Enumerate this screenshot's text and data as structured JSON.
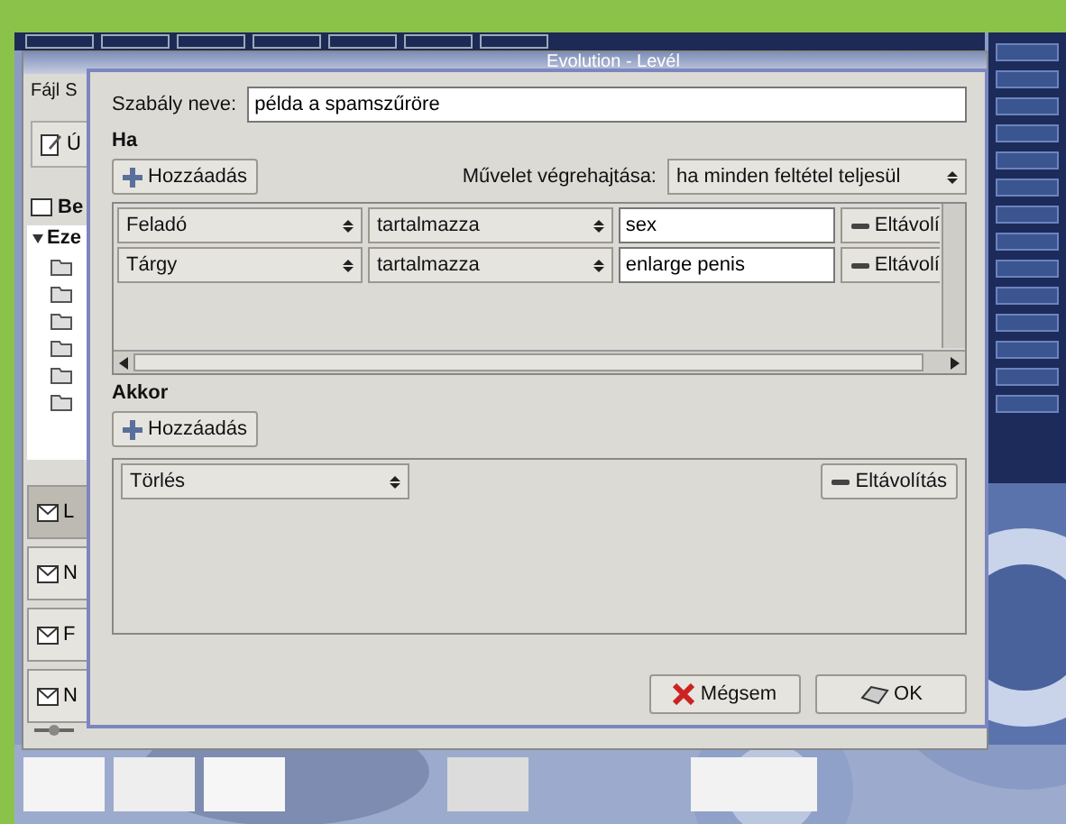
{
  "background_window": {
    "title": "Evolution - Levél",
    "menu": [
      "Fájl",
      "S"
    ],
    "toolbar_button": "Ú",
    "folder_header": "Be",
    "tree_root": "Eze",
    "sidebar_buttons": [
      {
        "label": "L",
        "selected": true
      },
      {
        "label": "N",
        "selected": false
      },
      {
        "label": "F",
        "selected": false
      },
      {
        "label": "N",
        "selected": false
      }
    ]
  },
  "dialog": {
    "name_label": "Szabály neve:",
    "name_value": "példa a spamszűröre",
    "if_heading": "Ha",
    "add_button": "Hozzáadás",
    "execute_label": "Művelet végrehajtása:",
    "execute_mode": "ha minden feltétel teljesül",
    "conditions": [
      {
        "field": "Feladó",
        "operator": "tartalmazza",
        "value": "sex",
        "remove_button": "Eltávolí"
      },
      {
        "field": "Tárgy",
        "operator": "tartalmazza",
        "value": "enlarge penis",
        "remove_button": "Eltávolí"
      }
    ],
    "then_heading": "Akkor",
    "then_add_button": "Hozzáadás",
    "actions": [
      {
        "action": "Törlés",
        "remove_button": "Eltávolítás"
      }
    ],
    "buttons": [
      {
        "label": "Mégsem",
        "kind": "cancel"
      },
      {
        "label": "OK",
        "kind": "ok"
      }
    ]
  }
}
